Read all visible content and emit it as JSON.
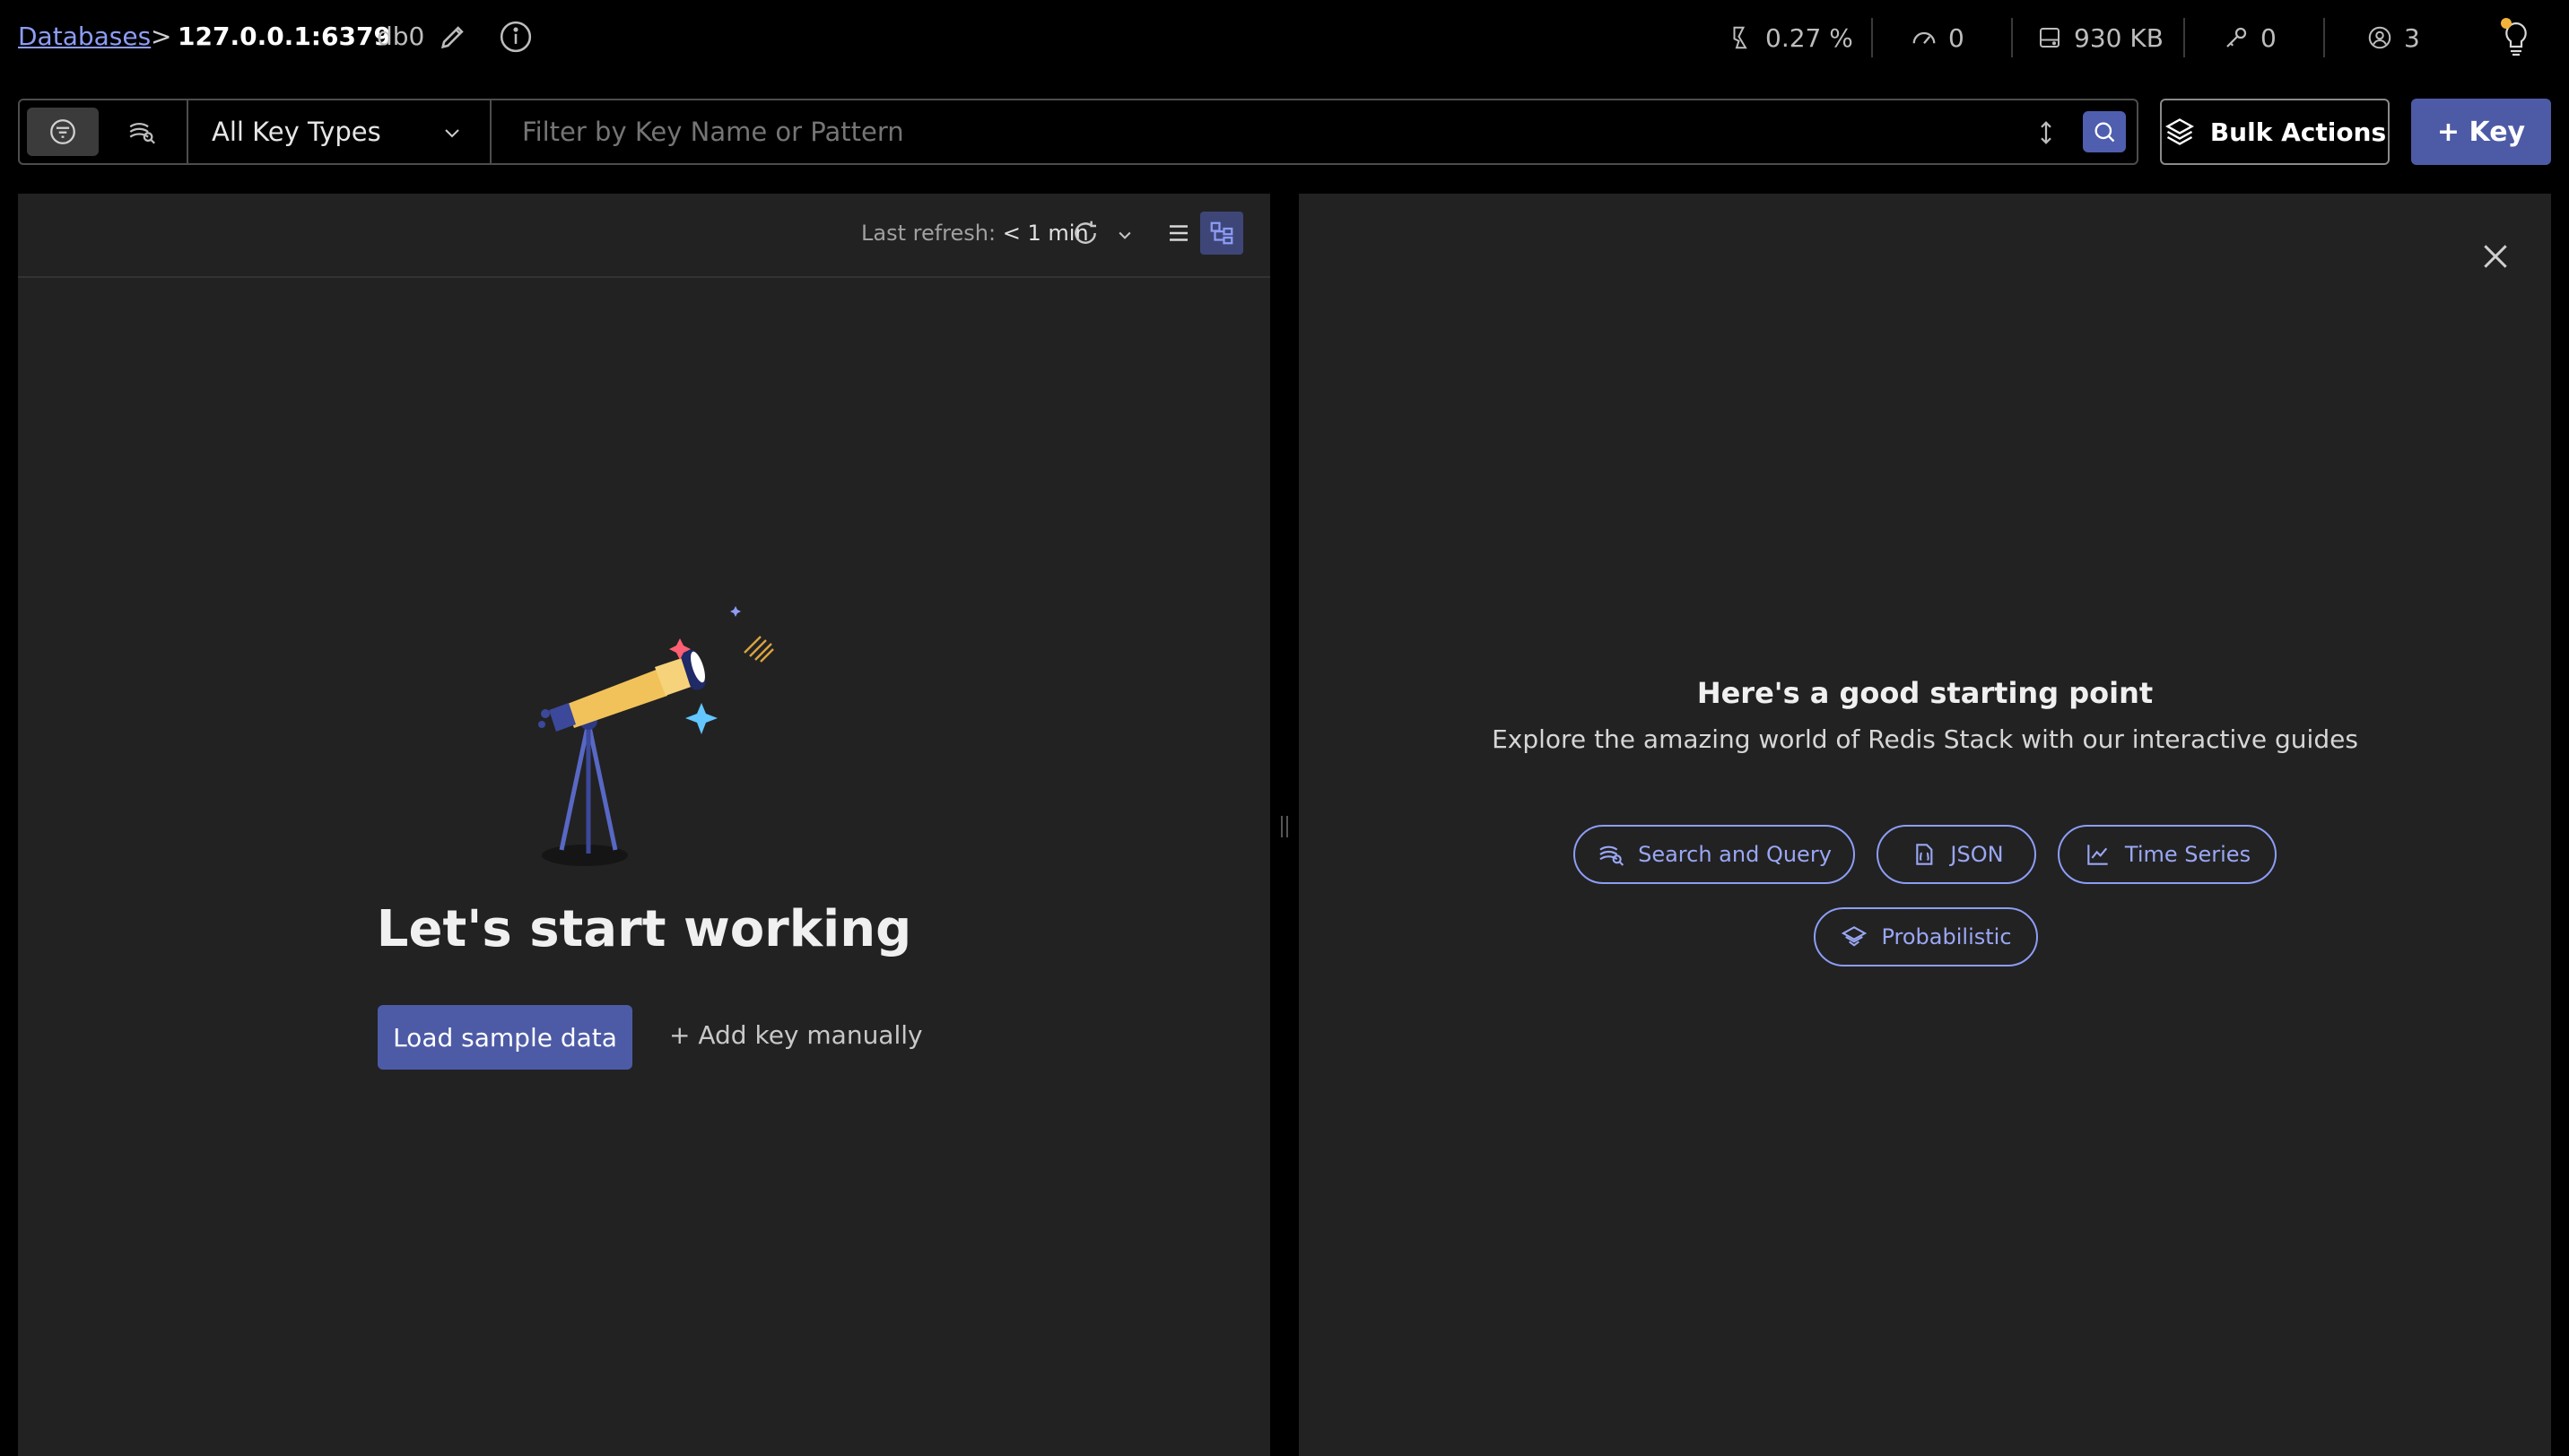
{
  "breadcrumb": {
    "databases_link": "Databases",
    "separator": ">",
    "host": "127.0.0.1:6379",
    "db": "db0"
  },
  "metrics": {
    "cpu": "0.27 %",
    "ops": "0",
    "memory": "930 KB",
    "keys": "0",
    "clients": "3"
  },
  "toolbar": {
    "key_type": "All Key Types",
    "search_placeholder": "Filter by Key Name or Pattern",
    "bulk_actions": "Bulk Actions",
    "add_key": "+ Key"
  },
  "browser": {
    "last_refresh_label": "Last refresh:",
    "last_refresh_value": "< 1 min",
    "empty_title": "Let's start working",
    "load_sample": "Load sample data",
    "add_manually": "+ Add key manually"
  },
  "guides": {
    "title": "Here's a good starting point",
    "subtitle": "Explore the amazing world of Redis Stack with our interactive guides",
    "items": [
      {
        "label": "Search and Query",
        "icon": "search-query-icon"
      },
      {
        "label": "JSON",
        "icon": "json-icon"
      },
      {
        "label": "Time Series",
        "icon": "chart-icon"
      },
      {
        "label": "Probabilistic",
        "icon": "layers-icon"
      }
    ]
  },
  "colors": {
    "accent": "#4d5ba6",
    "link": "#8d9df5",
    "panel": "#222223",
    "background": "#000000"
  }
}
